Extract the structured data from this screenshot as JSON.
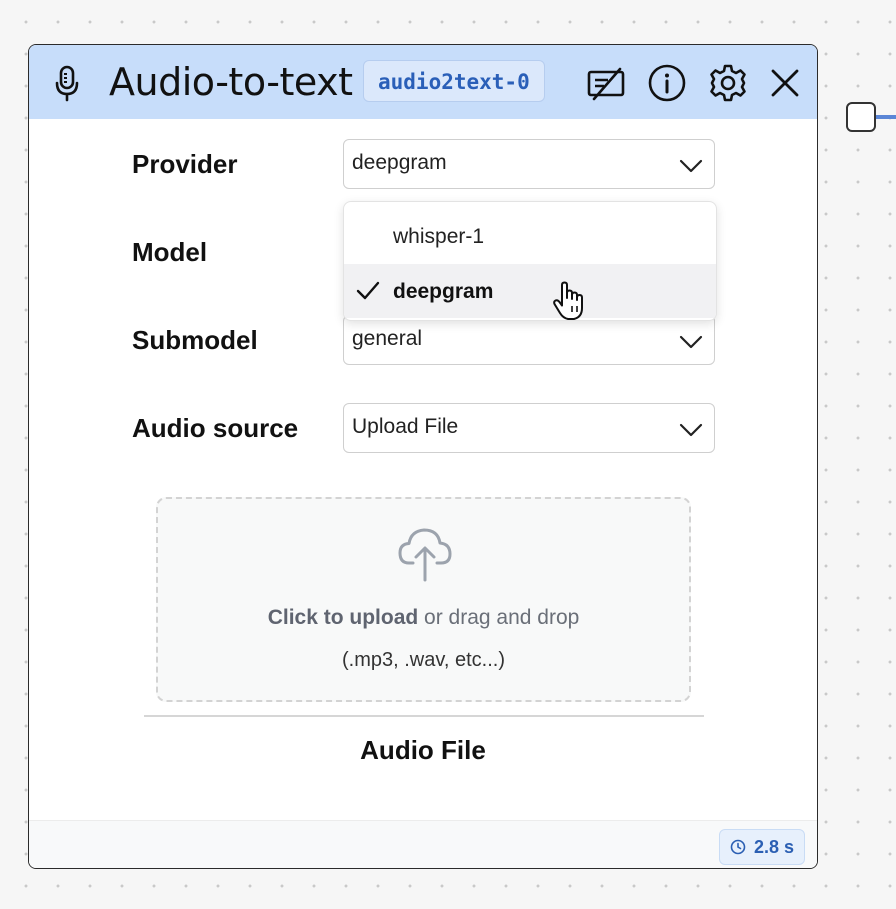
{
  "node": {
    "title": "Audio-to-text",
    "id_badge": "audio2text-0",
    "icons": {
      "node_type": "microphone-icon",
      "toggle": "edit-off-icon",
      "info": "info-icon",
      "settings": "gear-icon",
      "close": "close-icon"
    }
  },
  "fields": {
    "provider": {
      "label": "Provider",
      "value": "deepgram"
    },
    "model": {
      "label": "Model"
    },
    "submodel": {
      "label": "Submodel",
      "value": "general"
    },
    "audio_source": {
      "label": "Audio source",
      "value": "Upload File"
    }
  },
  "dropdown": {
    "options": [
      {
        "label": "whisper-1",
        "selected": false
      },
      {
        "label": "deepgram",
        "selected": true
      }
    ]
  },
  "upload": {
    "action": "Click to upload",
    "rest": " or drag and drop",
    "hint": "(.mp3, .wav, etc...)"
  },
  "output": {
    "label": "Audio File"
  },
  "footer": {
    "time": "2.8 s"
  },
  "colors": {
    "header_bg": "#c7ddfa",
    "accent": "#2a5fb8",
    "edge": "#5b86d6"
  }
}
